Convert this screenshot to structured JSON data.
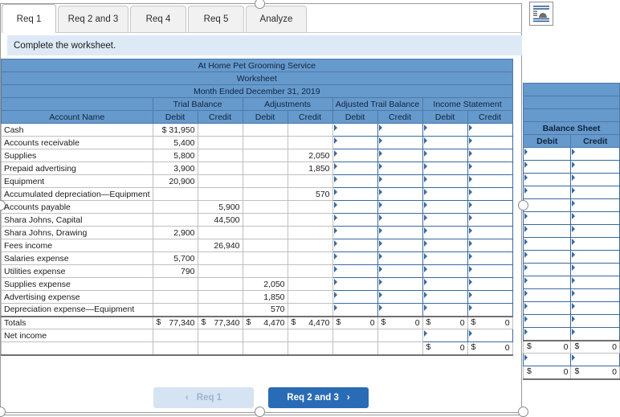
{
  "tabs": [
    {
      "label": "Req 1",
      "active": true
    },
    {
      "label": "Req 2 and 3",
      "active": false
    },
    {
      "label": "Req 4",
      "active": false
    },
    {
      "label": "Req 5",
      "active": false
    },
    {
      "label": "Analyze",
      "active": false
    }
  ],
  "instruction": "Complete the worksheet.",
  "worksheet": {
    "company": "At Home Pet Grooming Service",
    "title": "Worksheet",
    "period": "Month Ended December 31, 2019",
    "groups": [
      "Trial Balance",
      "Adjustments",
      "Adjusted Trail Balance",
      "Income Statement"
    ],
    "account_header": "Account Name",
    "sub_headers": [
      "Debit",
      "Credit"
    ],
    "balance_sheet_group": "Balance Sheet",
    "rows": [
      {
        "name": "Cash",
        "tb_d": "$   31,950",
        "tb_c": "",
        "adj_d": "",
        "adj_c": ""
      },
      {
        "name": "Accounts receivable",
        "tb_d": "5,400",
        "tb_c": "",
        "adj_d": "",
        "adj_c": ""
      },
      {
        "name": "Supplies",
        "tb_d": "5,800",
        "tb_c": "",
        "adj_d": "",
        "adj_c": "2,050"
      },
      {
        "name": "Prepaid advertising",
        "tb_d": "3,900",
        "tb_c": "",
        "adj_d": "",
        "adj_c": "1,850"
      },
      {
        "name": "Equipment",
        "tb_d": "20,900",
        "tb_c": "",
        "adj_d": "",
        "adj_c": ""
      },
      {
        "name": "Accumulated depreciation—Equipment",
        "tb_d": "",
        "tb_c": "",
        "adj_d": "",
        "adj_c": "570"
      },
      {
        "name": "Accounts payable",
        "tb_d": "",
        "tb_c": "5,900",
        "adj_d": "",
        "adj_c": ""
      },
      {
        "name": "Shara Johns, Capital",
        "tb_d": "",
        "tb_c": "44,500",
        "adj_d": "",
        "adj_c": ""
      },
      {
        "name": "Shara Johns, Drawing",
        "tb_d": "2,900",
        "tb_c": "",
        "adj_d": "",
        "adj_c": ""
      },
      {
        "name": "Fees income",
        "tb_d": "",
        "tb_c": "26,940",
        "adj_d": "",
        "adj_c": ""
      },
      {
        "name": "Salaries expense",
        "tb_d": "5,700",
        "tb_c": "",
        "adj_d": "",
        "adj_c": ""
      },
      {
        "name": "Utilities expense",
        "tb_d": "790",
        "tb_c": "",
        "adj_d": "",
        "adj_c": ""
      },
      {
        "name": "Supplies expense",
        "tb_d": "",
        "tb_c": "",
        "adj_d": "2,050",
        "adj_c": ""
      },
      {
        "name": "Advertising expense",
        "tb_d": "",
        "tb_c": "",
        "adj_d": "1,850",
        "adj_c": ""
      },
      {
        "name": "Depreciation expense—Equipment",
        "tb_d": "",
        "tb_c": "",
        "adj_d": "570",
        "adj_c": ""
      }
    ],
    "totals_row": {
      "name": "Totals",
      "tb_d": "77,340",
      "tb_c": "77,340",
      "adj_d": "4,470",
      "adj_c": "4,470",
      "atb_d": "0",
      "atb_c": "0",
      "is_d": "0",
      "is_c": "0",
      "bs_d": "0",
      "bs_c": "0"
    },
    "net_income_row": {
      "name": "Net income"
    },
    "final_row": {
      "is_d": "0",
      "is_c": "0",
      "bs_d": "0",
      "bs_c": "0"
    },
    "dollar": "$",
    "zero": "0"
  },
  "nav": {
    "prev_label": "Req 1",
    "prev_icon": "chevron-left",
    "next_label": "Req 2 and 3",
    "next_icon": "chevron-right"
  },
  "colors": {
    "header_blue": "#6699cc",
    "instruction_blue": "#ddeaf6",
    "next_button": "#2a6bb5",
    "prev_button": "#d6e3f2",
    "input_border": "#39699e"
  }
}
